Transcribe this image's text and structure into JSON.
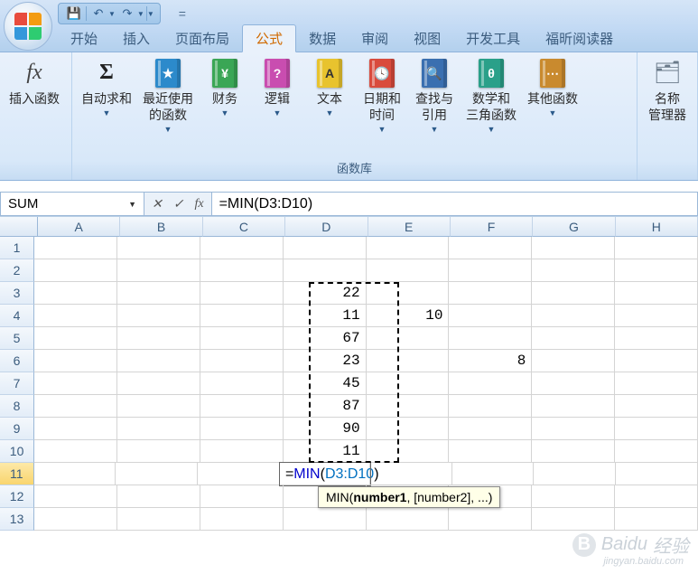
{
  "qat": {
    "equals": "="
  },
  "tabs": [
    "开始",
    "插入",
    "页面布局",
    "公式",
    "数据",
    "审阅",
    "视图",
    "开发工具",
    "福昕阅读器"
  ],
  "active_tab_index": 3,
  "ribbon": {
    "insert_fn": "插入函数",
    "autosum": "自动求和",
    "recent": "最近使用\n的函数",
    "financial": "财务",
    "logical": "逻辑",
    "text": "文本",
    "datetime": "日期和\n时间",
    "lookup": "查找与\n引用",
    "math": "数学和\n三角函数",
    "other": "其他函数",
    "name_mgr": "名称\n管理器",
    "group_label": "函数库"
  },
  "name_box": "SUM",
  "formula_bar": "=MIN(D3:D10)",
  "columns": [
    "A",
    "B",
    "C",
    "D",
    "E",
    "F",
    "G",
    "H"
  ],
  "row_count": 13,
  "active_row": 11,
  "cells": {
    "D3": "22",
    "D4": "11",
    "D5": "67",
    "D6": "23",
    "D7": "45",
    "D8": "87",
    "D9": "90",
    "D10": "11",
    "E4": "10",
    "F6": "8"
  },
  "editing_cell": {
    "eq": "=",
    "func": "MIN",
    "open": "(",
    "ref": "D3:D10",
    "close": ")"
  },
  "tooltip": {
    "fn": "MIN",
    "arg1": "number1",
    "rest": ", [number2], ...)"
  },
  "watermark": {
    "brand": "Baidu",
    "sub_cn": "经验",
    "url": "jingyan.baidu.com"
  }
}
